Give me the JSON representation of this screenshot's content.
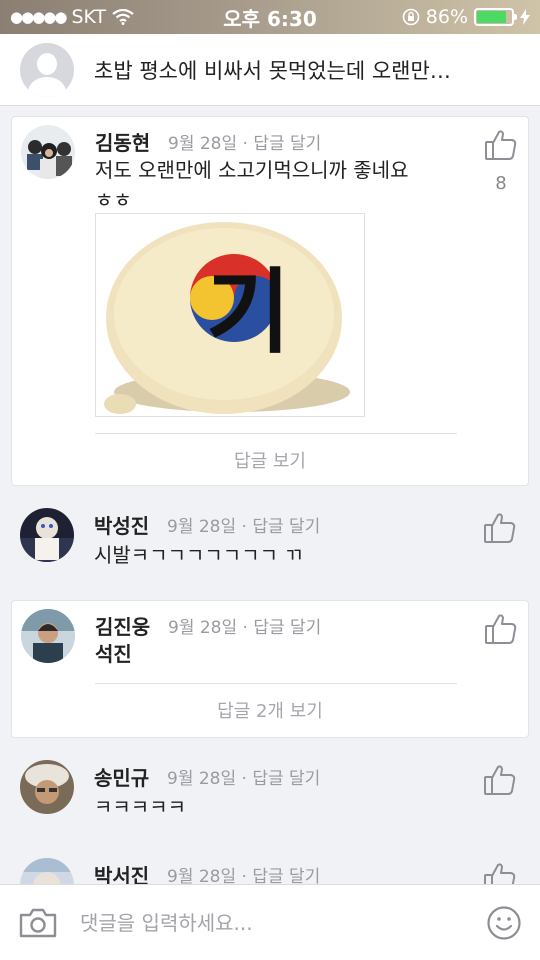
{
  "status_bar": {
    "signal_dots": "●●●●●",
    "carrier": "SKT",
    "time": "오후 6:30",
    "battery_percent": "86%",
    "battery_level": 0.86,
    "battery_color": "#4cd964"
  },
  "post": {
    "title": "초밥 평소에 비싸서 못먹었는데 오랜만…"
  },
  "comments": [
    {
      "name": "김동현",
      "date": "9월 28일",
      "separator": "·",
      "reply_label": "답글 달기",
      "text_line1": "저도 오랜만에 소고기먹으니까 좋네요",
      "text_line2": "ㅎㅎ",
      "like_count": "8",
      "attached_image": {
        "overlay_text": "기"
      },
      "view_replies_label": "답글 보기"
    },
    {
      "name": "박성진",
      "date": "9월 28일",
      "separator": "·",
      "reply_label": "답글 달기",
      "text_line1": "시발ㅋㄱㄱㄱㄱㄱㄱㄱ ㄲ"
    },
    {
      "name": "김진웅",
      "date": "9월 28일",
      "separator": "·",
      "reply_label": "답글 달기",
      "text_line1": "석진",
      "view_replies_label": "답글 2개 보기"
    },
    {
      "name": "송민규",
      "date": "9월 28일",
      "separator": "·",
      "reply_label": "답글 달기",
      "text_line1": "ㅋㅋㅋㅋㅋ"
    },
    {
      "name": "박서진",
      "date": "9월 28일",
      "separator": "·",
      "reply_label": "답글 달기"
    }
  ],
  "input_bar": {
    "placeholder": "댓글을 입력하세요...",
    "camera_icon": "camera-icon",
    "emoji_icon": "smiley-icon"
  },
  "colors": {
    "meta_gray": "#9a9ba2",
    "background": "#f1f2f6",
    "like_icon": "#8e8f96"
  }
}
